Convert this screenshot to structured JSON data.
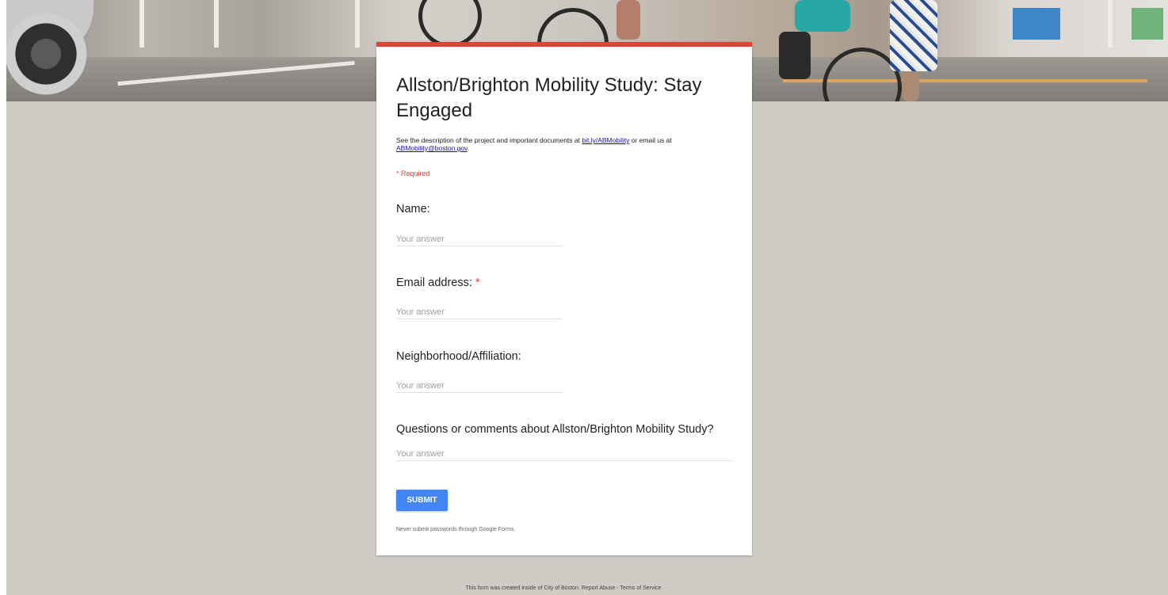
{
  "form": {
    "title": "Allston/Brighton Mobility Study: Stay Engaged",
    "description_prefix": "See the description of the project and important documents at ",
    "description_link": "bit.ly/ABMobility",
    "description_middle": " or email us at ",
    "description_email": "ABMobility@boston.gov",
    "description_suffix": ".",
    "required_note": "* Required",
    "accent_color": "#db4437",
    "background_color": "#cfccc6"
  },
  "questions": [
    {
      "label": "Name:",
      "required": false,
      "placeholder": "Your answer"
    },
    {
      "label": "Email address:",
      "required": true,
      "required_mark": "*",
      "placeholder": "Your answer"
    },
    {
      "label": "Neighborhood/Affiliation:",
      "required": false,
      "placeholder": "Your answer"
    },
    {
      "label": "Questions or comments about Allston/Brighton Mobility Study?",
      "required": false,
      "placeholder": "Your answer"
    }
  ],
  "submit": {
    "label": "SUBMIT",
    "color": "#4285f4"
  },
  "password_warning": "Never submit passwords through Google Forms.",
  "footer": {
    "text": "This form was created inside of City of Boston. Report Abuse - Terms of Service"
  }
}
